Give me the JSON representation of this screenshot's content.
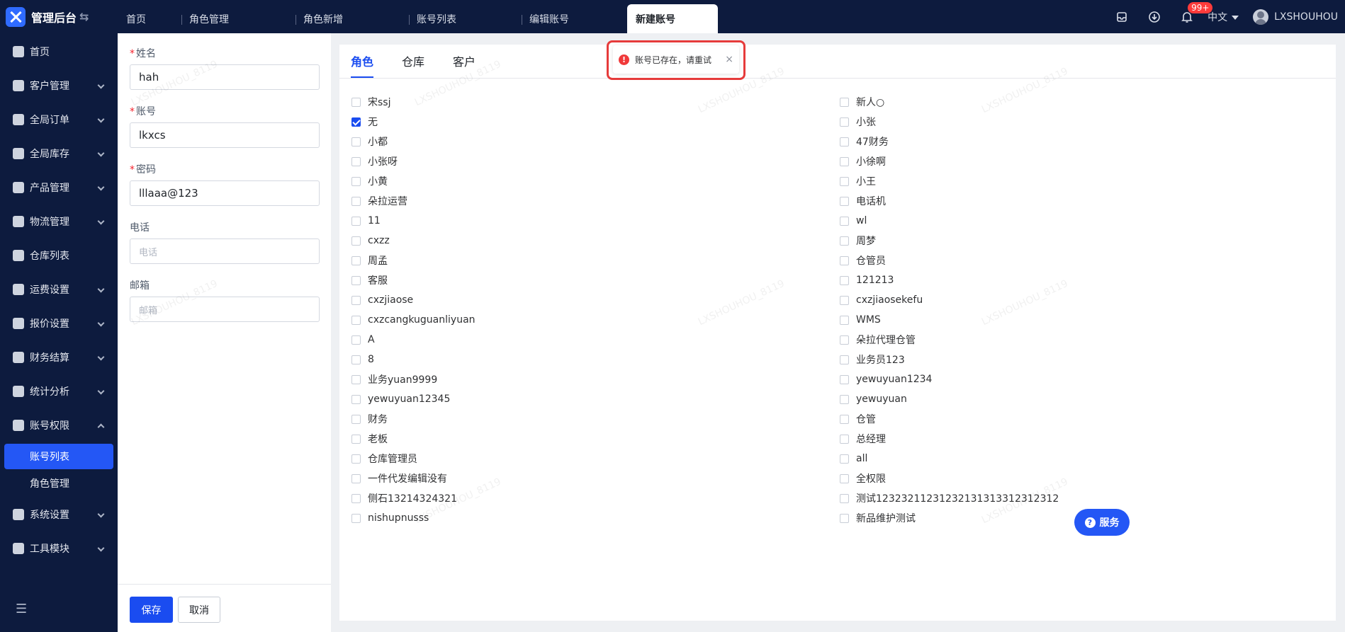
{
  "app": {
    "title": "管理后台"
  },
  "tabs": [
    {
      "label": "首页"
    },
    {
      "label": "角色管理"
    },
    {
      "label": "角色新增"
    },
    {
      "label": "账号列表"
    },
    {
      "label": "编辑账号"
    },
    {
      "label": "新建账号",
      "active": true
    }
  ],
  "header": {
    "notifications_badge": "99+",
    "language": "中文",
    "username": "LXSHOUHOU"
  },
  "sidebar": {
    "items": [
      {
        "label": "首页",
        "icon": "home-icon"
      },
      {
        "label": "客户管理",
        "icon": "users-icon",
        "expandable": true
      },
      {
        "label": "全局订单",
        "icon": "order-icon",
        "expandable": true
      },
      {
        "label": "全局库存",
        "icon": "warehouse-icon",
        "expandable": true
      },
      {
        "label": "产品管理",
        "icon": "box-icon",
        "expandable": true
      },
      {
        "label": "物流管理",
        "icon": "truck-icon",
        "expandable": true
      },
      {
        "label": "仓库列表",
        "icon": "store-icon"
      },
      {
        "label": "运费设置",
        "icon": "fee-icon",
        "expandable": true
      },
      {
        "label": "报价设置",
        "icon": "quote-icon",
        "expandable": true
      },
      {
        "label": "财务结算",
        "icon": "finance-icon",
        "expandable": true
      },
      {
        "label": "统计分析",
        "icon": "chart-icon",
        "expandable": true
      },
      {
        "label": "账号权限",
        "icon": "org-icon",
        "expanded": true,
        "children": [
          {
            "label": "账号列表",
            "active": true
          },
          {
            "label": "角色管理"
          }
        ]
      },
      {
        "label": "系统设置",
        "icon": "gear-icon",
        "expandable": true
      },
      {
        "label": "工具模块",
        "icon": "wrench-icon",
        "expandable": true
      }
    ]
  },
  "form": {
    "name": {
      "label": "姓名",
      "value": "hah",
      "required": true
    },
    "account": {
      "label": "账号",
      "value": "lkxcs",
      "required": true
    },
    "password": {
      "label": "密码",
      "value": "lllaaa@123",
      "required": true
    },
    "phone": {
      "label": "电话",
      "placeholder": "电话"
    },
    "email": {
      "label": "邮箱",
      "placeholder": "邮箱"
    },
    "save_label": "保存",
    "cancel_label": "取消"
  },
  "role_tabs": [
    {
      "label": "角色",
      "active": true
    },
    {
      "label": "仓库"
    },
    {
      "label": "客户"
    }
  ],
  "roles": [
    {
      "name": "宋ssj",
      "checked": false
    },
    {
      "name": "新人○",
      "checked": false
    },
    {
      "name": "无",
      "checked": true
    },
    {
      "name": "小张",
      "checked": false
    },
    {
      "name": "小都",
      "checked": false
    },
    {
      "name": "47财务",
      "checked": false
    },
    {
      "name": "小张呀",
      "checked": false
    },
    {
      "name": "小徐啊",
      "checked": false
    },
    {
      "name": "小黄",
      "checked": false
    },
    {
      "name": "小王",
      "checked": false
    },
    {
      "name": "朵拉运营",
      "checked": false
    },
    {
      "name": "电话机",
      "checked": false
    },
    {
      "name": "11",
      "checked": false
    },
    {
      "name": "wl",
      "checked": false
    },
    {
      "name": "cxzz",
      "checked": false
    },
    {
      "name": "周梦",
      "checked": false
    },
    {
      "name": "周孟",
      "checked": false
    },
    {
      "name": "仓管员",
      "checked": false
    },
    {
      "name": "客服",
      "checked": false
    },
    {
      "name": "121213",
      "checked": false
    },
    {
      "name": "cxzjiaose",
      "checked": false
    },
    {
      "name": "cxzjiaosekefu",
      "checked": false
    },
    {
      "name": "cxzcangkuguanliyuan",
      "checked": false
    },
    {
      "name": "WMS",
      "checked": false
    },
    {
      "name": "A",
      "checked": false
    },
    {
      "name": "朵拉代理仓管",
      "checked": false
    },
    {
      "name": "8",
      "checked": false
    },
    {
      "name": "业务员123",
      "checked": false
    },
    {
      "name": "业务yuan9999",
      "checked": false
    },
    {
      "name": "yewuyuan1234",
      "checked": false
    },
    {
      "name": "yewuyuan12345",
      "checked": false
    },
    {
      "name": "yewuyuan",
      "checked": false
    },
    {
      "name": "财务",
      "checked": false
    },
    {
      "name": "仓管",
      "checked": false
    },
    {
      "name": "老板",
      "checked": false
    },
    {
      "name": "总经理",
      "checked": false
    },
    {
      "name": "仓库管理员",
      "checked": false
    },
    {
      "name": "all",
      "checked": false
    },
    {
      "name": "一件代发编辑没有",
      "checked": false
    },
    {
      "name": "全权限",
      "checked": false
    },
    {
      "name": "侧石13214324321",
      "checked": false
    },
    {
      "name": "测试12323211231232131313312312312",
      "checked": false
    },
    {
      "name": "nishupnusss",
      "checked": false
    },
    {
      "name": "新品维护测试",
      "checked": false
    }
  ],
  "toast": {
    "message": "账号已存在，请重试"
  },
  "service_button": {
    "label": "服务"
  },
  "watermark": "LXSHOUHOU_8119"
}
